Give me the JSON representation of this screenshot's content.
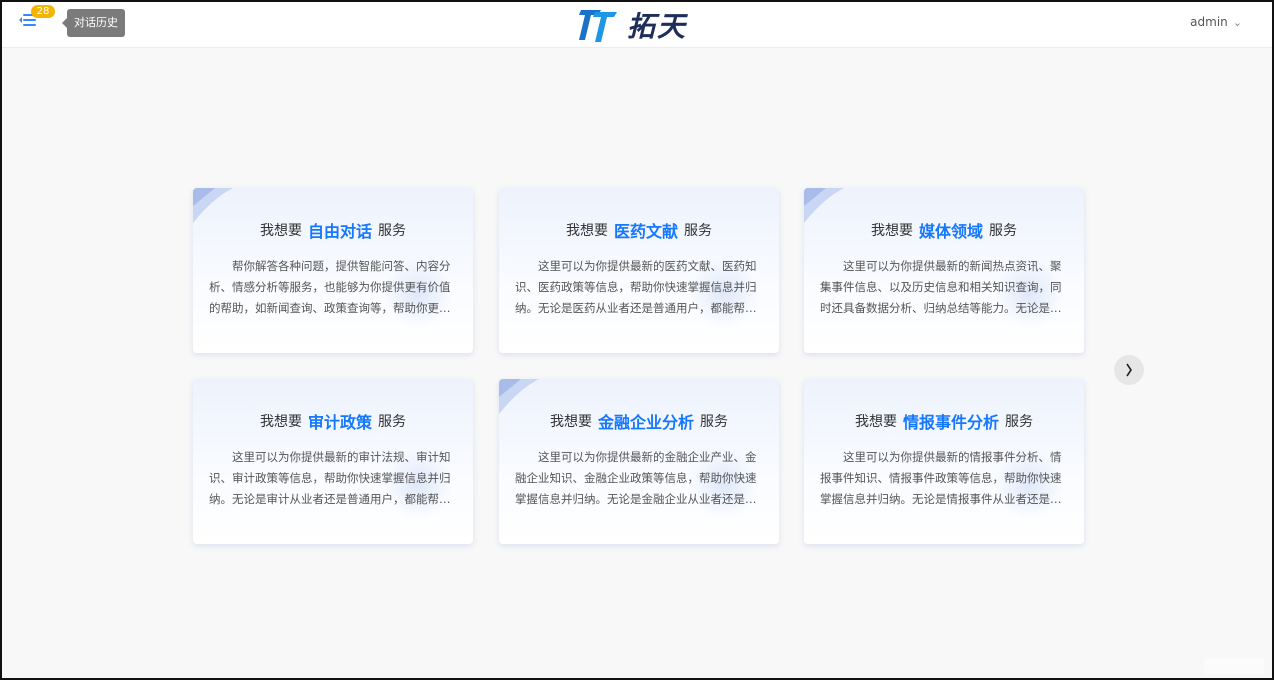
{
  "header": {
    "history_badge": "28",
    "history_tooltip": "对话历史",
    "logo_text": "拓天",
    "user_name": "admin"
  },
  "cards": [
    {
      "prefix": "我想要",
      "keyword": "自由对话",
      "suffix": "服务",
      "description": "帮你解答各种问题，提供智能问答、内容分析、情感分析等服务，也能够为你提供更有价值的帮助，如新闻查询、政策查询等，帮助你更…"
    },
    {
      "prefix": "我想要",
      "keyword": "医药文献",
      "suffix": "服务",
      "description": "这里可以为你提供最新的医药文献、医药知识、医药政策等信息，帮助你快速掌握信息并归纳。无论是医药从业者还是普通用户，都能帮…"
    },
    {
      "prefix": "我想要",
      "keyword": "媒体领域",
      "suffix": "服务",
      "description": "这里可以为你提供最新的新闻热点资讯、聚集事件信息、以及历史信息和相关知识查询，同时还具备数据分析、归纳总结等能力。无论是…"
    },
    {
      "prefix": "我想要",
      "keyword": "审计政策",
      "suffix": "服务",
      "description": "这里可以为你提供最新的审计法规、审计知识、审计政策等信息，帮助你快速掌握信息并归纳。无论是审计从业者还是普通用户，都能帮…"
    },
    {
      "prefix": "我想要",
      "keyword": "金融企业分析",
      "suffix": "服务",
      "description": "这里可以为你提供最新的金融企业产业、金融企业知识、金融企业政策等信息，帮助你快速掌握信息并归纳。无论是金融企业从业者还是…"
    },
    {
      "prefix": "我想要",
      "keyword": "情报事件分析",
      "suffix": "服务",
      "description": "这里可以为你提供最新的情报事件分析、情报事件知识、情报事件政策等信息，帮助你快速掌握信息并归纳。无论是情报事件从业者还是…"
    }
  ],
  "navigation": {
    "next_icon": "chevron-right-icon"
  },
  "colors": {
    "accent": "#1677ff",
    "badge": "#f4b400",
    "tooltip_bg": "#7b7b7b"
  }
}
